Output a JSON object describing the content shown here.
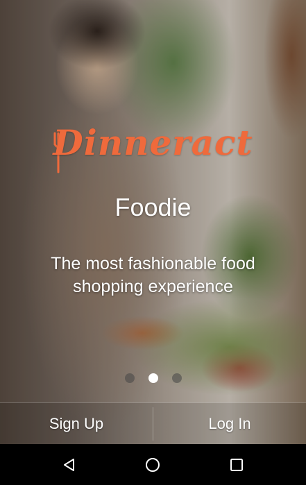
{
  "brand": {
    "logo_text": "Dinneract",
    "accent_color": "#ef6a3c"
  },
  "intro": {
    "title": "Foodie",
    "tagline": "The most fashionable food shopping experience"
  },
  "pager": {
    "page_count": 3,
    "active_index": 1
  },
  "actions": {
    "sign_up_label": "Sign Up",
    "log_in_label": "Log In"
  },
  "navbar": {
    "back_icon": "back-triangle-icon",
    "home_icon": "home-circle-icon",
    "recents_icon": "recents-square-icon"
  }
}
